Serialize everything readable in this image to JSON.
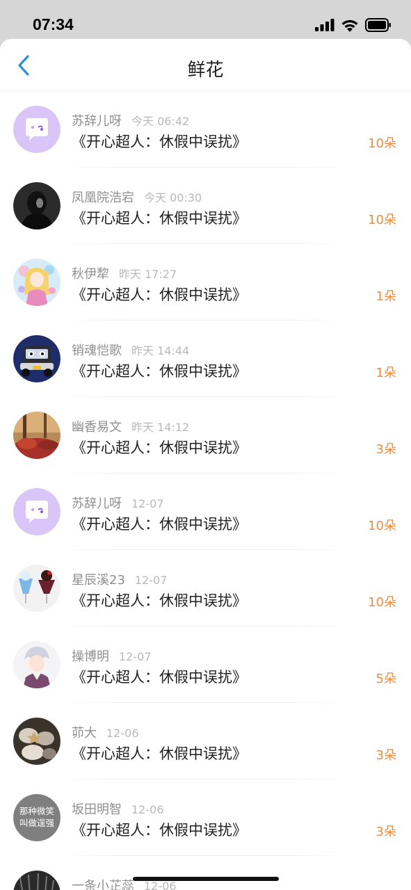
{
  "status": {
    "time": "07:34"
  },
  "header": {
    "title": "鲜花",
    "back_icon": "chevron-left-icon"
  },
  "colors": {
    "accent": "#f08a3c",
    "back": "#2a8fd8"
  },
  "items": [
    {
      "name": "苏辞儿呀",
      "time": "今天 06:42",
      "book": "《开心超人：休假中误扰》",
      "count": "10朵"
    },
    {
      "name": "凤凰院浩宕",
      "time": "今天 00:30",
      "book": "《开心超人：休假中误扰》",
      "count": "10朵"
    },
    {
      "name": "秋伊犂",
      "time": "昨天 17:27",
      "book": "《开心超人：休假中误扰》",
      "count": "1朵"
    },
    {
      "name": "销魂恺歌",
      "time": "昨天 14:44",
      "book": "《开心超人：休假中误扰》",
      "count": "1朵"
    },
    {
      "name": "幽香易文",
      "time": "昨天 14:12",
      "book": "《开心超人：休假中误扰》",
      "count": "3朵"
    },
    {
      "name": "苏辞儿呀",
      "time": "12-07",
      "book": "《开心超人：休假中误扰》",
      "count": "10朵"
    },
    {
      "name": "星辰溪23",
      "time": "12-07",
      "book": "《开心超人：休假中误扰》",
      "count": "10朵"
    },
    {
      "name": "操博明",
      "time": "12-07",
      "book": "《开心超人：休假中误扰》",
      "count": "5朵"
    },
    {
      "name": "茆大",
      "time": "12-06",
      "book": "《开心超人：休假中误扰》",
      "count": "3朵"
    },
    {
      "name": "坂田明智",
      "time": "12-06",
      "book": "《开心超人：休假中误扰》",
      "count": "3朵",
      "avatar_text": "那种微笑 叫做逞强"
    },
    {
      "name": "一条小芷蕊",
      "time": "12-06",
      "book": "",
      "count": ""
    }
  ]
}
